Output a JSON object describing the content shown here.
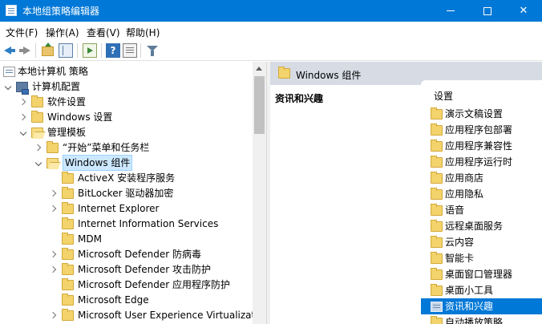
{
  "window": {
    "title": "本地组策略编辑器"
  },
  "menu": [
    "文件(F)",
    "操作(A)",
    "查看(V)",
    "帮助(H)"
  ],
  "toolbar": {
    "buttons": [
      "back-icon",
      "forward-icon",
      "up-one-level-icon",
      "show-hide-tree-icon",
      "export-list-icon",
      "help-icon",
      "properties-icon",
      "filter-icon"
    ],
    "help_glyph": "?"
  },
  "tree": [
    {
      "label": "本地计算机 策略",
      "depth": 0,
      "expand": "none",
      "icon": "policy"
    },
    {
      "label": "计算机配置",
      "depth": 1,
      "expand": "down",
      "icon": "computer"
    },
    {
      "label": "软件设置",
      "depth": 2,
      "expand": "right",
      "icon": "folder"
    },
    {
      "label": "Windows 设置",
      "depth": 2,
      "expand": "right",
      "icon": "folder"
    },
    {
      "label": "管理模板",
      "depth": 2,
      "expand": "down",
      "icon": "folder-open"
    },
    {
      "label": "“开始”菜单和任务栏",
      "depth": 3,
      "expand": "right",
      "icon": "folder"
    },
    {
      "label": "Windows 组件",
      "depth": 3,
      "expand": "down",
      "icon": "folder-open",
      "selected": true
    },
    {
      "label": "ActiveX 安装程序服务",
      "depth": 4,
      "expand": "none",
      "icon": "folder"
    },
    {
      "label": "BitLocker 驱动器加密",
      "depth": 4,
      "expand": "right",
      "icon": "folder"
    },
    {
      "label": "Internet Explorer",
      "depth": 4,
      "expand": "right",
      "icon": "folder"
    },
    {
      "label": "Internet Information Services",
      "depth": 4,
      "expand": "none",
      "icon": "folder"
    },
    {
      "label": "MDM",
      "depth": 4,
      "expand": "none",
      "icon": "folder"
    },
    {
      "label": "Microsoft Defender 防病毒",
      "depth": 4,
      "expand": "right",
      "icon": "folder"
    },
    {
      "label": "Microsoft Defender 攻击防护",
      "depth": 4,
      "expand": "right",
      "icon": "folder"
    },
    {
      "label": "Microsoft Defender 应用程序防护",
      "depth": 4,
      "expand": "none",
      "icon": "folder"
    },
    {
      "label": "Microsoft Edge",
      "depth": 4,
      "expand": "none",
      "icon": "folder"
    },
    {
      "label": "Microsoft User Experience Virtualization",
      "depth": 4,
      "expand": "right",
      "icon": "folder"
    }
  ],
  "right": {
    "header": "Windows 组件",
    "description_title": "资讯和兴趣",
    "list_header": "设置",
    "items": [
      {
        "label": "演示文稿设置",
        "icon": "folder"
      },
      {
        "label": "应用程序包部署",
        "icon": "folder"
      },
      {
        "label": "应用程序兼容性",
        "icon": "folder"
      },
      {
        "label": "应用程序运行时",
        "icon": "folder"
      },
      {
        "label": "应用商店",
        "icon": "folder"
      },
      {
        "label": "应用隐私",
        "icon": "folder"
      },
      {
        "label": "语音",
        "icon": "folder"
      },
      {
        "label": "远程桌面服务",
        "icon": "folder"
      },
      {
        "label": "云内容",
        "icon": "folder"
      },
      {
        "label": "智能卡",
        "icon": "folder"
      },
      {
        "label": "桌面窗口管理器",
        "icon": "folder"
      },
      {
        "label": "桌面小工具",
        "icon": "folder"
      },
      {
        "label": "资讯和兴趣",
        "icon": "policy",
        "selected": true
      },
      {
        "label": "自动播放策略",
        "icon": "folder"
      }
    ]
  }
}
